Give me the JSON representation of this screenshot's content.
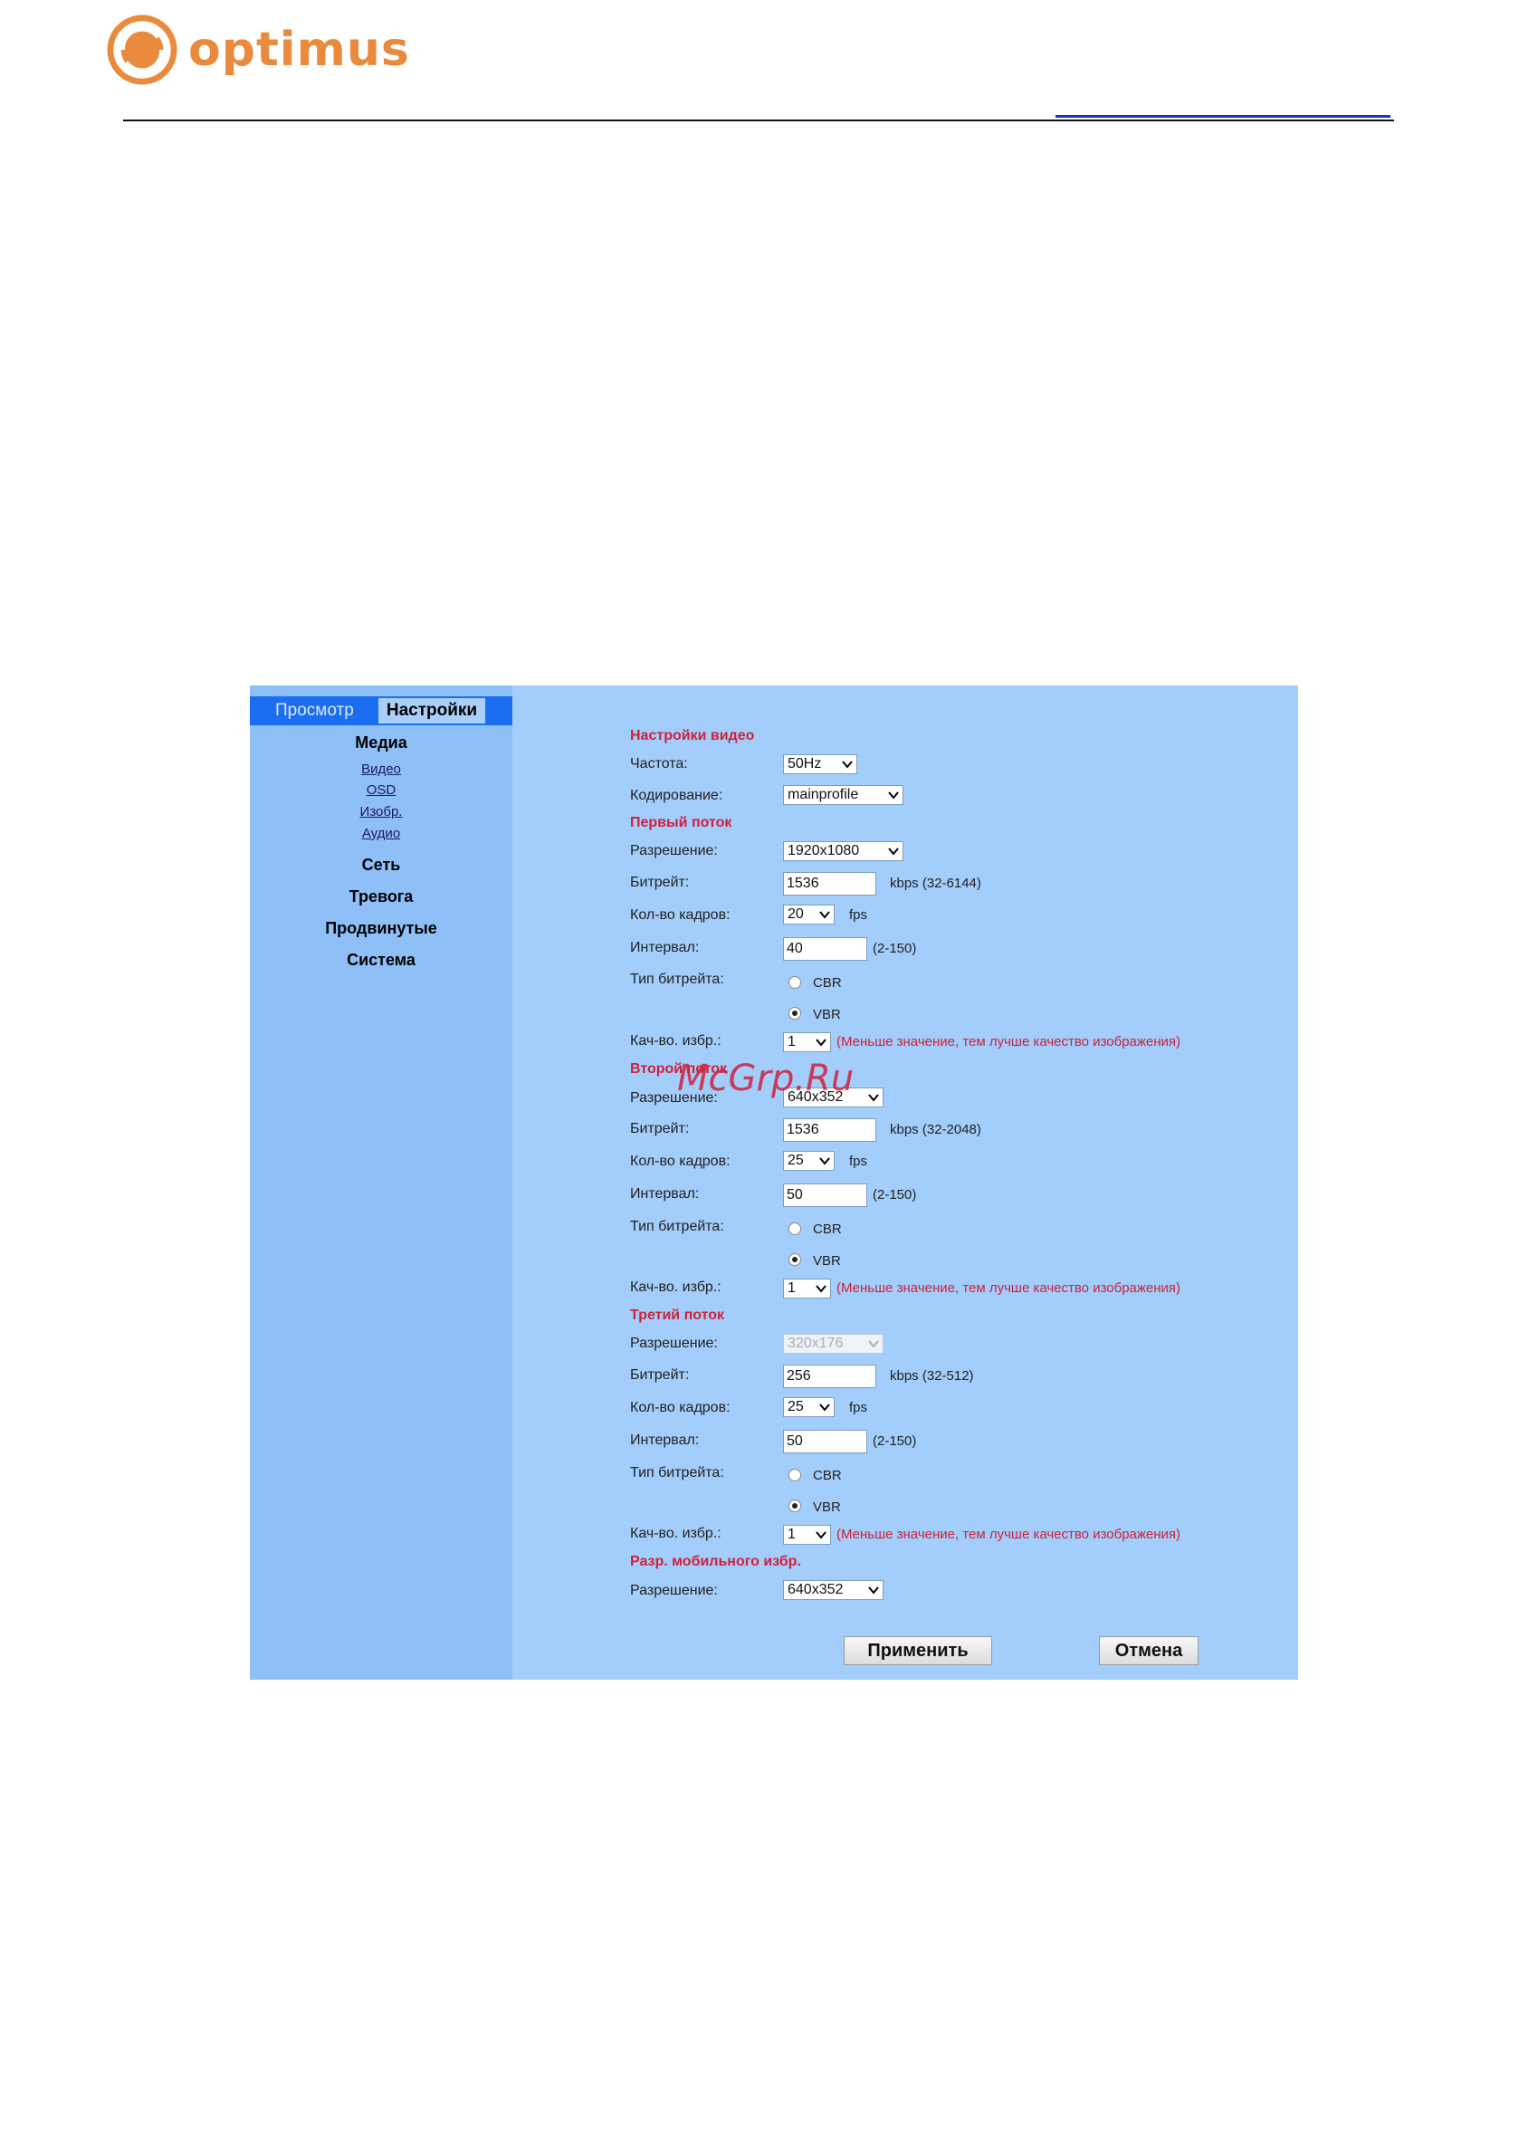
{
  "header": {
    "brand": "optimus"
  },
  "tabs": {
    "preview": "Просмотр",
    "settings": "Настройки"
  },
  "sidebar": {
    "media": "Медиа",
    "media_items": [
      "Видео",
      "OSD",
      "Изобр.",
      "Аудио"
    ],
    "network": "Сеть",
    "alarm": "Тревога",
    "advanced": "Продвинутые",
    "system": "Система"
  },
  "form": {
    "video_settings": {
      "title": "Настройки видео",
      "frequency_label": "Частота:",
      "frequency_value": "50Hz",
      "encoding_label": "Кодирование:",
      "encoding_value": "mainprofile"
    },
    "stream1": {
      "title": "Первый поток",
      "resolution_label": "Разрешение:",
      "resolution_value": "1920x1080",
      "bitrate_label": "Битрейт:",
      "bitrate_value": "1536",
      "bitrate_unit": "kbps (32-6144)",
      "fps_label": "Кол-во кадров:",
      "fps_value": "20",
      "fps_unit": "fps",
      "interval_label": "Интервал:",
      "interval_value": "40",
      "interval_range": "(2-150)",
      "bitrate_type_label": "Тип битрейта:",
      "cbr": "CBR",
      "vbr": "VBR",
      "selected": "VBR",
      "quality_label": "Кач-во. избр.:",
      "quality_value": "1",
      "quality_hint": "(Меньше значение, тем лучше качество изображения)"
    },
    "stream2": {
      "title": "Второй поток",
      "resolution_label": "Разрешение:",
      "resolution_value": "640x352",
      "bitrate_label": "Битрейт:",
      "bitrate_value": "1536",
      "bitrate_unit": "kbps (32-2048)",
      "fps_label": "Кол-во кадров:",
      "fps_value": "25",
      "fps_unit": "fps",
      "interval_label": "Интервал:",
      "interval_value": "50",
      "interval_range": "(2-150)",
      "bitrate_type_label": "Тип битрейта:",
      "cbr": "CBR",
      "vbr": "VBR",
      "selected": "VBR",
      "quality_label": "Кач-во. избр.:",
      "quality_value": "1",
      "quality_hint": "(Меньше значение, тем лучше качество изображения)"
    },
    "stream3": {
      "title": "Третий поток",
      "resolution_label": "Разрешение:",
      "resolution_value": "320x176",
      "bitrate_label": "Битрейт:",
      "bitrate_value": "256",
      "bitrate_unit": "kbps (32-512)",
      "fps_label": "Кол-во кадров:",
      "fps_value": "25",
      "fps_unit": "fps",
      "interval_label": "Интервал:",
      "interval_value": "50",
      "interval_range": "(2-150)",
      "bitrate_type_label": "Тип битрейта:",
      "cbr": "CBR",
      "vbr": "VBR",
      "selected": "VBR",
      "quality_label": "Кач-во. избр.:",
      "quality_value": "1",
      "quality_hint": "(Меньше значение, тем лучше качество изображения)"
    },
    "mobile": {
      "title": "Разр. мобильного избр.",
      "resolution_label": "Разрешение:",
      "resolution_value": "640x352"
    },
    "apply_button": "Применить",
    "cancel_button": "Отмена"
  },
  "watermark": "McGrp.Ru",
  "colors": {
    "brand": "#e98a3c",
    "panel": "#a3cdfb",
    "tab_bar": "#1b6ef0",
    "section": "#d0213a"
  }
}
